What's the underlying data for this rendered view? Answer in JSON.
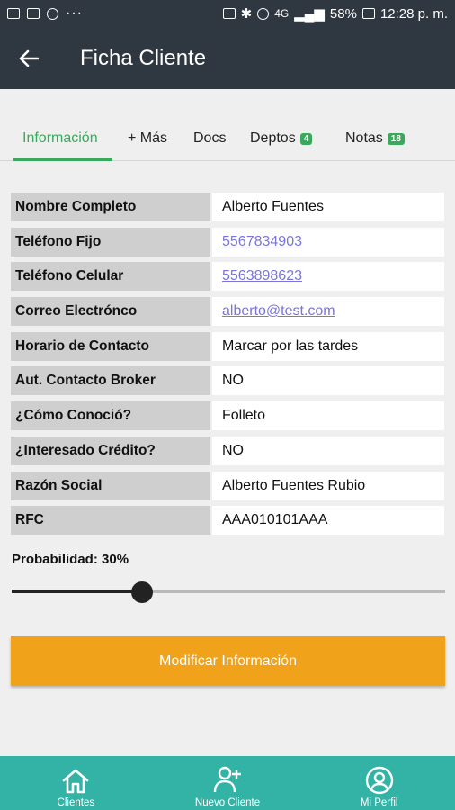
{
  "status_bar": {
    "dots": "···",
    "signal_text": "4G",
    "battery": "58%",
    "time": "12:28 p. m."
  },
  "app_bar": {
    "title": "Ficha Cliente",
    "back_icon": "arrow-left-icon"
  },
  "tabs": [
    {
      "label": "Información",
      "active": true
    },
    {
      "label": "+ Más"
    },
    {
      "label": "Docs"
    },
    {
      "label": "Deptos",
      "badge": "4"
    },
    {
      "label": "Notas",
      "badge": "18"
    }
  ],
  "fields": [
    {
      "label": "Nombre Completo",
      "value": "Alberto Fuentes"
    },
    {
      "label": "Teléfono Fijo",
      "value": "5567834903",
      "link": true
    },
    {
      "label": "Teléfono Celular",
      "value": "5563898623",
      "link": true
    },
    {
      "label": "Correo Electrónco",
      "value": "alberto@test.com",
      "link": true
    },
    {
      "label": "Horario de Contacto",
      "value": "Marcar por las tardes"
    },
    {
      "label": "Aut. Contacto Broker",
      "value": "NO"
    },
    {
      "label": "¿Cómo Conoció?",
      "value": "Folleto"
    },
    {
      "label": "¿Interesado Crédito?",
      "value": "NO"
    },
    {
      "label": "Razón Social",
      "value": "Alberto Fuentes Rubio"
    },
    {
      "label": "RFC",
      "value": "AAA010101AAA"
    }
  ],
  "probability": {
    "label": "Probabilidad: 30%",
    "value_percent": 30
  },
  "modify_button": {
    "label": "Modificar Información"
  },
  "bottom_nav": [
    {
      "label": "Clientes",
      "icon": "home-icon"
    },
    {
      "label": "Nuevo Cliente",
      "icon": "add-user-icon"
    },
    {
      "label": "Mi Perfil",
      "icon": "profile-icon"
    }
  ],
  "colors": {
    "app_bar": "#2f3740",
    "accent_green": "#3aa95b",
    "button_orange": "#f0a21b",
    "bottom_nav": "#33b3a6",
    "link": "#7a75d6"
  }
}
